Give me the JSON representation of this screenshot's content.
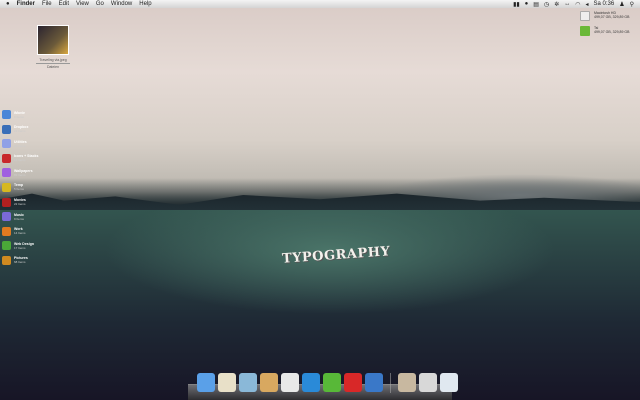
{
  "menubar": {
    "apple": "",
    "items": [
      "Finder",
      "File",
      "Edit",
      "View",
      "Go",
      "Window",
      "Help"
    ],
    "clock": "Sa 0:36",
    "status_icons": [
      "bluetooth-icon",
      "location-icon",
      "battery-icon",
      "sync-icon",
      "gear-icon",
      "network-icon",
      "wifi-icon",
      "volume-icon"
    ]
  },
  "desktop_file": {
    "name": "Traveling via.jpeg",
    "sub": "Dateien"
  },
  "widgets": [
    {
      "name": "Macintosh HD",
      "detail": "499,07 GB, 329,89 GB"
    },
    {
      "name": "Tsi",
      "detail": "499,07 GB, 329,89 GB"
    }
  ],
  "sidebar": [
    {
      "label": "iMovie",
      "count": "9 Items",
      "color": "#4a86d8"
    },
    {
      "label": "Dropbox",
      "count": "23 Items",
      "color": "#3a6fb8"
    },
    {
      "label": "Utilities",
      "count": "29 Items",
      "color": "#8fa0e6"
    },
    {
      "label": "Icons + Stacks",
      "count": "14 Items",
      "color": "#c8282c"
    },
    {
      "label": "Wallpapers",
      "count": "83 Items",
      "color": "#a060e0"
    },
    {
      "label": "Temp",
      "count": "5 Items",
      "color": "#d6b820"
    },
    {
      "label": "Movies",
      "count": "22 Items",
      "color": "#b32020"
    },
    {
      "label": "Music",
      "count": "9 Items",
      "color": "#7a6ad8"
    },
    {
      "label": "Work",
      "count": "14 Items",
      "color": "#e07a20"
    },
    {
      "label": "Web Design",
      "count": "17 Items",
      "color": "#4aa838"
    },
    {
      "label": "Pictures",
      "count": "68 Items",
      "color": "#d08a20"
    }
  ],
  "wallpaper_text": "TYPOGRAPHY",
  "dock": [
    {
      "name": "finder",
      "color": "#5aa0e8"
    },
    {
      "name": "mail",
      "color": "#e8e0c8"
    },
    {
      "name": "safari",
      "color": "#8ab8d8"
    },
    {
      "name": "tweetie",
      "color": "#d8a860"
    },
    {
      "name": "itunes",
      "color": "#e8e8e8"
    },
    {
      "name": "app-store",
      "color": "#2a8ad8"
    },
    {
      "name": "coda",
      "color": "#58b838"
    },
    {
      "name": "magnet",
      "color": "#d82828"
    },
    {
      "name": "things",
      "color": "#3a78c8"
    },
    {
      "name": "downloads",
      "color": "#c8b8a0"
    },
    {
      "name": "documents",
      "color": "#d8d8d8"
    },
    {
      "name": "trash",
      "color": "#e0e8f0"
    }
  ]
}
